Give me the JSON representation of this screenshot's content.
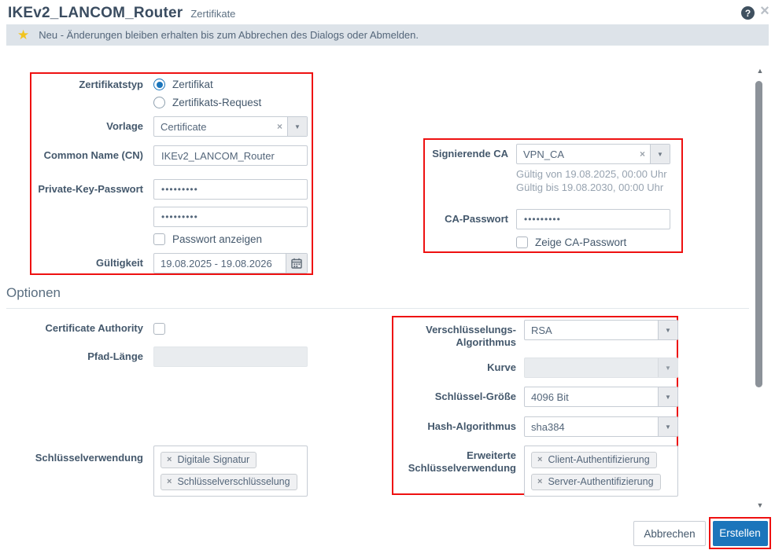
{
  "header": {
    "title": "IKEv2_LANCOM_Router",
    "subtitle": "Zertifikate"
  },
  "icons": {
    "help": "?",
    "close": "×",
    "star": "★",
    "clear": "×",
    "dropdown_arrow": "▼",
    "tag_remove": "×",
    "scroll_up": "▲",
    "scroll_down": "▼"
  },
  "notice": {
    "text": "Neu - Änderungen bleiben erhalten bis zum Abbrechen des Dialogs oder Abmelden."
  },
  "form": {
    "zertifikatstyp": {
      "label": "Zertifikatstyp",
      "options": [
        {
          "label": "Zertifikat",
          "selected": true
        },
        {
          "label": "Zertifikats-Request",
          "selected": false
        }
      ]
    },
    "vorlage": {
      "label": "Vorlage",
      "value": "Certificate"
    },
    "common_name": {
      "label": "Common Name (CN)",
      "value": "IKEv2_LANCOM_Router"
    },
    "private_key_passwort": {
      "label": "Private-Key-Passwort",
      "value": "•••••••••",
      "confirm_value": "•••••••••"
    },
    "passwort_anzeigen": {
      "label": "Passwort anzeigen",
      "checked": false
    },
    "gueltigkeit": {
      "label": "Gültigkeit",
      "value": "19.08.2025 - 19.08.2026"
    },
    "signierende_ca": {
      "label": "Signierende CA",
      "value": "VPN_CA",
      "info_line1": "Gültig von 19.08.2025, 00:00 Uhr",
      "info_line2": "Gültig bis 19.08.2030, 00:00 Uhr"
    },
    "ca_passwort": {
      "label": "CA-Passwort",
      "value": "•••••••••"
    },
    "zeige_ca_passwort": {
      "label": "Zeige CA-Passwort",
      "checked": false
    }
  },
  "optionen": {
    "section_title": "Optionen",
    "certificate_authority": {
      "label": "Certificate Authority",
      "checked": false
    },
    "pfad_laenge": {
      "label": "Pfad-Länge",
      "value": "",
      "disabled": true
    },
    "schluesselverwendung": {
      "label": "Schlüsselverwendung",
      "tags": [
        "Digitale Signatur",
        "Schlüsselverschlüsselung"
      ]
    },
    "verschluesselungs_algorithmus": {
      "label_line1": "Verschlüsselungs-",
      "label_line2": "Algorithmus",
      "value": "RSA"
    },
    "kurve": {
      "label": "Kurve",
      "value": "",
      "disabled": true
    },
    "schluessel_groesse": {
      "label": "Schlüssel-Größe",
      "value": "4096 Bit"
    },
    "hash_algorithmus": {
      "label": "Hash-Algorithmus",
      "value": "sha384"
    },
    "erweiterte_schluesselverwendung": {
      "label_line1": "Erweiterte",
      "label_line2": "Schlüsselverwendung",
      "tags": [
        "Client-Authentifizierung",
        "Server-Authentifizierung"
      ]
    }
  },
  "footer": {
    "cancel_label": "Abbrechen",
    "create_label": "Erstellen"
  },
  "colors": {
    "accent_blue": "#1b75bb",
    "highlight_red": "#ee1111",
    "star_yellow": "#f2c41d",
    "notice_bg": "#dde3e9"
  }
}
